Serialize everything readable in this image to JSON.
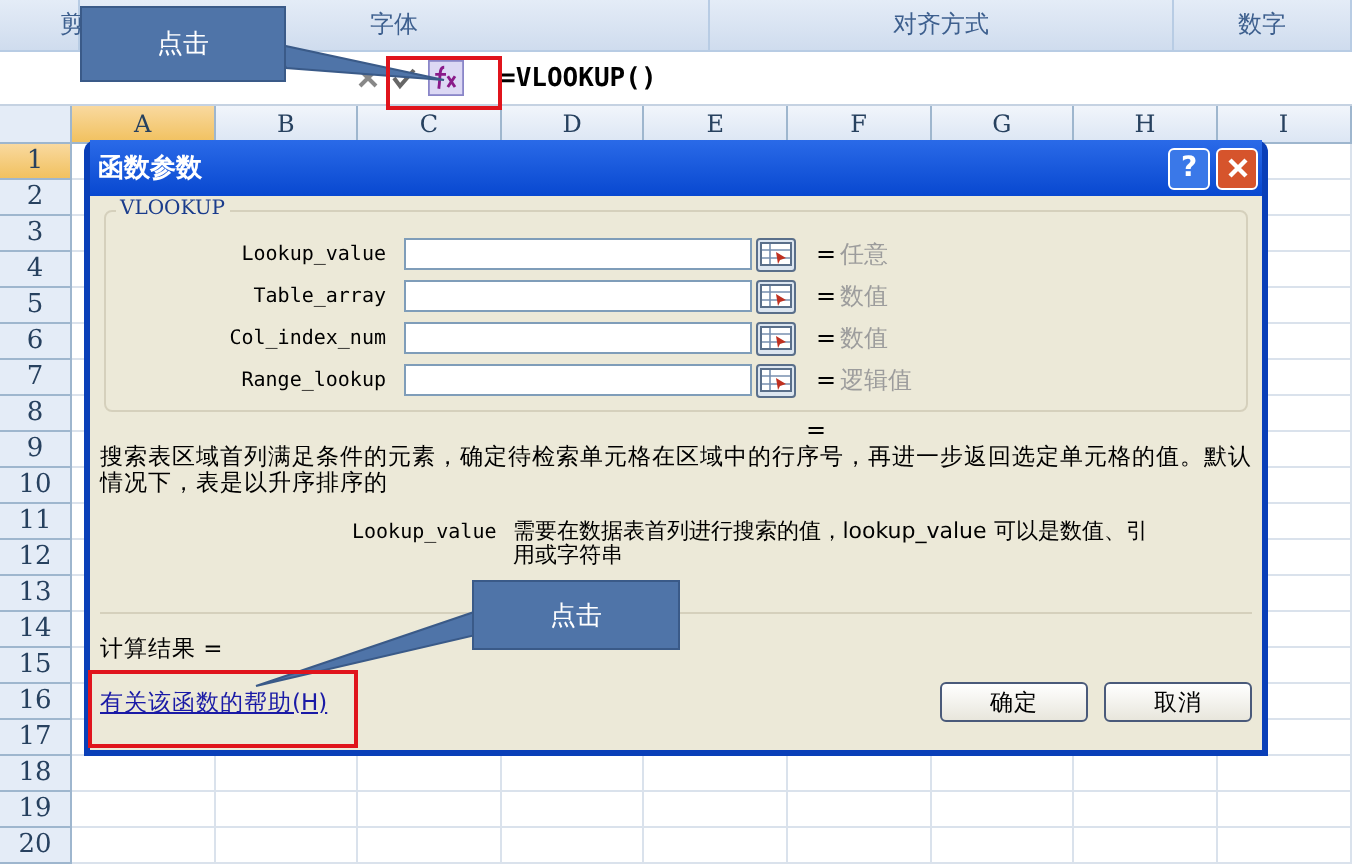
{
  "ribbon_groups": [
    {
      "label": "剪"
    },
    {
      "label": "字体"
    },
    {
      "label": "对齐方式"
    },
    {
      "label": "数字"
    }
  ],
  "formula_bar": {
    "formula": "=VLOOKUP()"
  },
  "columns": [
    {
      "label": "A",
      "selected": true
    },
    {
      "label": "B",
      "selected": false
    },
    {
      "label": "C",
      "selected": false
    },
    {
      "label": "D",
      "selected": false
    },
    {
      "label": "E",
      "selected": false
    },
    {
      "label": "F",
      "selected": false
    },
    {
      "label": "G",
      "selected": false
    },
    {
      "label": "H",
      "selected": false
    },
    {
      "label": "I",
      "selected": false
    }
  ],
  "rows": [
    {
      "label": "1",
      "selected": true
    },
    {
      "label": "2",
      "selected": false
    },
    {
      "label": "3",
      "selected": false
    },
    {
      "label": "4",
      "selected": false
    },
    {
      "label": "5",
      "selected": false
    },
    {
      "label": "6",
      "selected": false
    },
    {
      "label": "7",
      "selected": false
    },
    {
      "label": "8",
      "selected": false
    },
    {
      "label": "9",
      "selected": false
    },
    {
      "label": "10",
      "selected": false
    },
    {
      "label": "11",
      "selected": false
    },
    {
      "label": "12",
      "selected": false
    },
    {
      "label": "13",
      "selected": false
    },
    {
      "label": "14",
      "selected": false
    },
    {
      "label": "15",
      "selected": false
    },
    {
      "label": "16",
      "selected": false
    },
    {
      "label": "17",
      "selected": false
    },
    {
      "label": "18",
      "selected": false
    },
    {
      "label": "19",
      "selected": false
    },
    {
      "label": "20",
      "selected": false
    }
  ],
  "dialog": {
    "title": "函数参数",
    "help_button": "?",
    "group_title": "VLOOKUP",
    "arguments": [
      {
        "name": "Lookup_value",
        "result": "任意"
      },
      {
        "name": "Table_array",
        "result": "数值"
      },
      {
        "name": "Col_index_num",
        "result": "数值"
      },
      {
        "name": "Range_lookup",
        "result": "逻辑值"
      }
    ],
    "equals_sign": "=",
    "arg_equals": "=",
    "description": "搜索表区域首列满足条件的元素，确定待检索单元格在区域中的行序号，再进一步返回选定单元格的值。默认情况下，表是以升序排序的",
    "arg_help": {
      "name": "Lookup_value",
      "text": "需要在数据表首列进行搜索的值，lookup_value 可以是数值、引用或字符串"
    },
    "result_label": "计算结果 =",
    "help_link": "有关该函数的帮助(H)",
    "buttons": [
      "确定",
      "取消"
    ]
  },
  "callouts": [
    {
      "text": "点击"
    },
    {
      "text": "点击"
    }
  ]
}
